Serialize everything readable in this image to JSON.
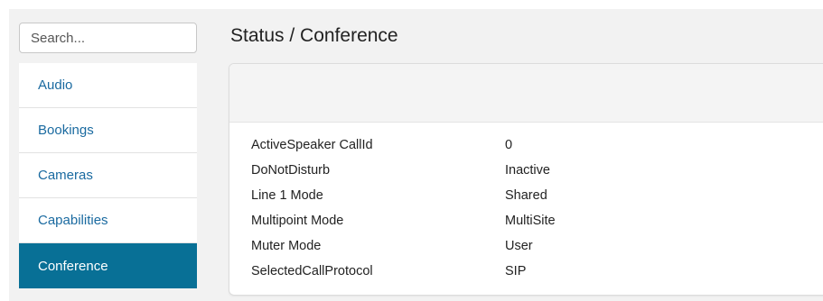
{
  "search": {
    "placeholder": "Search..."
  },
  "sidebar": {
    "items": [
      {
        "label": "Audio"
      },
      {
        "label": "Bookings"
      },
      {
        "label": "Cameras"
      },
      {
        "label": "Capabilities"
      },
      {
        "label": "Conference",
        "active": true
      }
    ]
  },
  "main": {
    "title": "Status / Conference",
    "rows": [
      {
        "key": "ActiveSpeaker CallId",
        "value": "0"
      },
      {
        "key": "DoNotDisturb",
        "value": "Inactive"
      },
      {
        "key": "Line 1 Mode",
        "value": "Shared"
      },
      {
        "key": "Multipoint Mode",
        "value": "MultiSite"
      },
      {
        "key": "Muter Mode",
        "value": "User"
      },
      {
        "key": "SelectedCallProtocol",
        "value": "SIP"
      }
    ]
  },
  "colors": {
    "accent": "#087096",
    "link": "#1a6aa0",
    "background": "#f2f2f2"
  }
}
